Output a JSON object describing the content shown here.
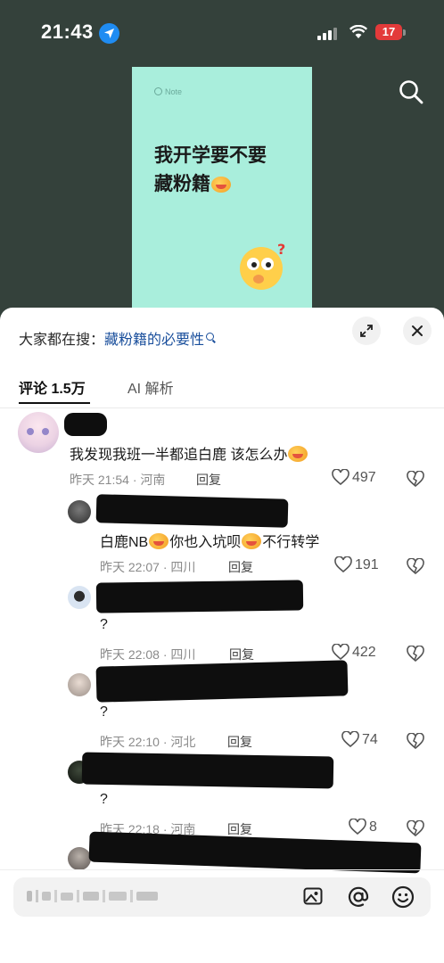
{
  "status_bar": {
    "time": "21:43",
    "battery": "17"
  },
  "video": {
    "note_logo": "Note",
    "note_title_line1": "我开学要不要",
    "note_title_line2": "藏粉籍"
  },
  "sheet": {
    "search_prefix": "大家都在搜：",
    "search_keyword": "藏粉籍的必要性",
    "tabs": [
      {
        "label": "评论 1.5万"
      },
      {
        "label": "AI 解析"
      }
    ]
  },
  "comments": [
    {
      "text": "我发现我班一半都追白鹿 该怎么办",
      "time": "昨天 21:54",
      "location": "河南",
      "reply_label": "回复",
      "likes": "497"
    },
    {
      "text_a": "白鹿NB",
      "text_b": "你也入坑呗",
      "text_c": "不行转学",
      "time": "昨天 22:07",
      "location": "四川",
      "reply_label": "回复",
      "likes": "191"
    },
    {
      "text": "?",
      "time": "昨天 22:08",
      "location": "四川",
      "reply_label": "回复",
      "likes": "422"
    },
    {
      "text": "?",
      "time": "昨天 22:10",
      "location": "河北",
      "reply_label": "回复",
      "likes": "74"
    },
    {
      "text": "?",
      "time": "昨天 22:18",
      "location": "河南",
      "reply_label": "回复",
      "likes": "8"
    }
  ],
  "colors": {
    "accent_keyword": "#1a4f9c",
    "battery": "#e33a3a",
    "note_bg": "#a9eedc",
    "video_bg": "#34413b"
  },
  "icons": [
    "location-arrow-icon",
    "signal-icon",
    "wifi-icon",
    "search-icon",
    "expand-icon",
    "close-icon",
    "heart-icon",
    "broken-heart-icon",
    "image-icon",
    "at-icon",
    "emoji-icon"
  ]
}
